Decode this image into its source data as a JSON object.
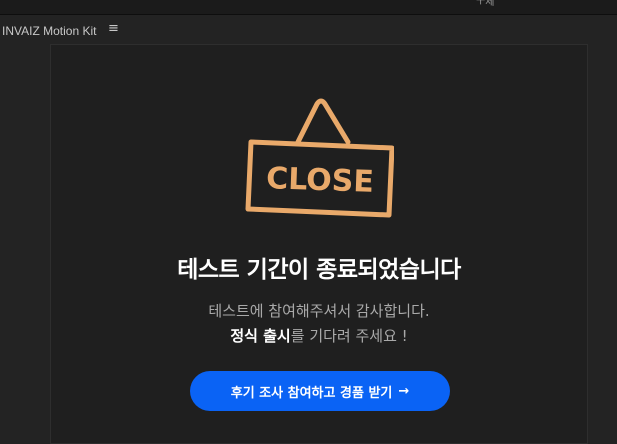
{
  "topbar": {
    "fragment_text": "ㅜ제"
  },
  "panel": {
    "title": "INVAIZ Motion Kit",
    "menu_glyph": "≡"
  },
  "sign": {
    "text": "CLOSE",
    "icon": "close-sign-icon",
    "color": "#e9a96a"
  },
  "main": {
    "headline": "테스트 기간이 종료되었습니다",
    "message_line1": "테스트에 참여해주셔서 감사합니다.",
    "message_line2_strong": "정식 출시",
    "message_line2_rest": "를 기다려 주세요 !",
    "cta_label": "후기 조사 참여하고 경품 받기",
    "cta_arrow": "→",
    "cta_color": "#0a63f5"
  }
}
